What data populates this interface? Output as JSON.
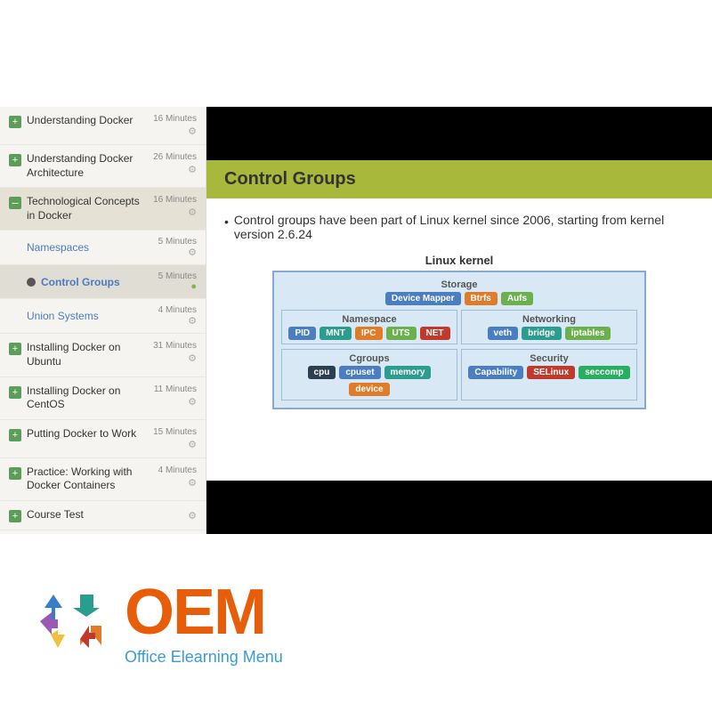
{
  "top_area": {},
  "sidebar": {
    "items": [
      {
        "id": "understanding-docker",
        "type": "plus",
        "label": "Understanding Docker",
        "duration": "16 Minutes",
        "expanded": false
      },
      {
        "id": "understanding-docker-arch",
        "type": "plus",
        "label": "Understanding Docker Architecture",
        "duration": "26 Minutes",
        "expanded": false
      },
      {
        "id": "tech-concepts-docker",
        "type": "minus",
        "label": "Technological Concepts in Docker",
        "duration": "16 Minutes",
        "expanded": true,
        "subitems": [
          {
            "id": "namespaces",
            "label": "Namespaces",
            "duration": "5 Minutes",
            "active": false
          },
          {
            "id": "control-groups",
            "label": "Control Groups",
            "duration": "5 Minutes",
            "active": true
          },
          {
            "id": "union-systems",
            "label": "Union Systems",
            "duration": "4 Minutes",
            "active": false
          }
        ]
      },
      {
        "id": "installing-ubuntu",
        "type": "plus",
        "label": "Installing Docker on Ubuntu",
        "duration": "31 Minutes",
        "expanded": false
      },
      {
        "id": "installing-centos",
        "type": "plus",
        "label": "Installing Docker on CentOS",
        "duration": "11 Minutes",
        "expanded": false
      },
      {
        "id": "putting-to-work",
        "type": "plus",
        "label": "Putting Docker to Work",
        "duration": "15 Minutes",
        "expanded": false
      },
      {
        "id": "practice-working",
        "type": "plus",
        "label": "Practice: Working with Docker Containers",
        "duration": "4 Minutes",
        "expanded": false
      },
      {
        "id": "course-test",
        "type": "plus",
        "label": "Course Test",
        "duration": "",
        "expanded": false
      }
    ]
  },
  "slide": {
    "title": "Control Groups",
    "bullet": "Control groups have been part of Linux kernel since 2006, starting from kernel version 2.6.24",
    "diagram": {
      "title": "Linux kernel",
      "storage_label": "Storage",
      "storage_chips": [
        "Device Mapper",
        "Btrfs",
        "Aufs"
      ],
      "namespace_label": "Namespace",
      "namespace_chips": [
        "PID",
        "MNT",
        "IPC",
        "UTS",
        "NET"
      ],
      "networking_label": "Networking",
      "networking_chips": [
        "veth",
        "bridge",
        "iptables"
      ],
      "cgroups_label": "Cgroups",
      "cgroups_chips": [
        "cpu",
        "cpuset",
        "memory",
        "device"
      ],
      "security_label": "Security",
      "security_chips": [
        "Capability",
        "SELinux",
        "seccomp"
      ]
    }
  },
  "branding": {
    "logo_text": "OEM",
    "subtitle": "Office Elearning Menu"
  },
  "icons": {
    "plus": "+",
    "minus": "−",
    "bullet": "•",
    "gear": "⚙"
  }
}
